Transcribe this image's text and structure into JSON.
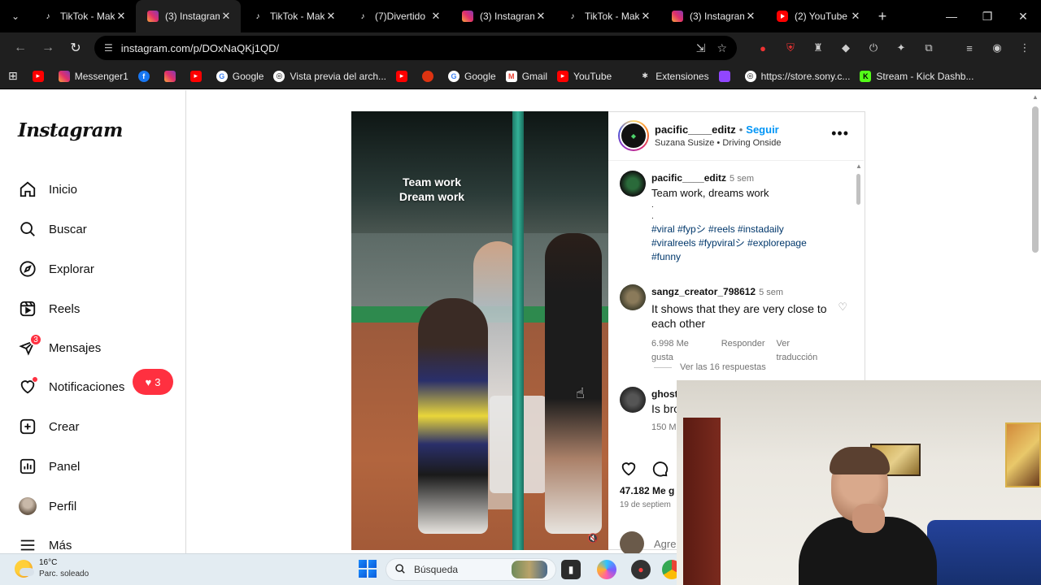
{
  "browser": {
    "tabs": [
      {
        "icon": "tiktok-icon",
        "title": "TikTok - Mak",
        "active": false
      },
      {
        "icon": "instagram-icon",
        "title": "(3) Instagram",
        "active": true
      },
      {
        "icon": "tiktok-icon",
        "title": "TikTok - Mak",
        "active": false
      },
      {
        "icon": "tiktok-icon",
        "title": "(7)Divertido",
        "active": false
      },
      {
        "icon": "instagram-icon",
        "title": "(3) Instagram",
        "active": false
      },
      {
        "icon": "tiktok-icon",
        "title": "TikTok - Mak",
        "active": false
      },
      {
        "icon": "instagram-icon",
        "title": "(3) Instagram",
        "active": false
      },
      {
        "icon": "youtube-icon",
        "title": "(2) YouTube",
        "active": false
      }
    ],
    "url": "instagram.com/p/DOxNaQKj1QD/",
    "bookmarks": [
      {
        "icon": "youtube-icon",
        "label": ""
      },
      {
        "icon": "instagram-icon",
        "label": "Messenger1"
      },
      {
        "icon": "facebook-icon",
        "label": ""
      },
      {
        "icon": "instagram-icon",
        "label": ""
      },
      {
        "icon": "youtube-icon",
        "label": ""
      },
      {
        "icon": "google-icon",
        "label": "Google"
      },
      {
        "icon": "web-icon",
        "label": "Vista previa del arch..."
      },
      {
        "icon": "youtube-icon",
        "label": ""
      },
      {
        "icon": "web-icon",
        "label": ""
      },
      {
        "icon": "google-icon",
        "label": "Google"
      },
      {
        "icon": "gmail-icon",
        "label": "Gmail"
      },
      {
        "icon": "youtube-icon",
        "label": "YouTube"
      },
      {
        "icon": "extensions-icon",
        "label": "Extensiones"
      },
      {
        "icon": "twitch-icon",
        "label": ""
      },
      {
        "icon": "web-icon",
        "label": "https://store.sony.c..."
      },
      {
        "icon": "kick-icon",
        "label": "Stream - Kick Dashb..."
      }
    ]
  },
  "instagram": {
    "logo": "Instagram",
    "nav": [
      {
        "label": "Inicio",
        "icon": "home-icon"
      },
      {
        "label": "Buscar",
        "icon": "search-icon"
      },
      {
        "label": "Explorar",
        "icon": "compass-icon"
      },
      {
        "label": "Reels",
        "icon": "reels-icon"
      },
      {
        "label": "Mensajes",
        "icon": "messenger-icon",
        "badge": "3"
      },
      {
        "label": "Notificaciones",
        "icon": "heart-icon"
      },
      {
        "label": "Crear",
        "icon": "plus-square-icon"
      },
      {
        "label": "Panel",
        "icon": "chart-icon"
      },
      {
        "label": "Perfil",
        "icon": "avatar-icon"
      },
      {
        "label": "Más",
        "icon": "menu-icon"
      }
    ],
    "notification_pill": "3",
    "post": {
      "overlay_text": "Team work\nDream work",
      "author": "pacific____editz",
      "follow": "Seguir",
      "music": "Suzana Susize • Driving Onside",
      "caption": {
        "user": "pacific____editz",
        "time": "5 sem",
        "text": "Team work, dreams work",
        "dots": ".",
        "dots2": ".",
        "hashtags_line1": "#viral #fypシ #reels #instadaily",
        "hashtags_line2": "#viralreels #fypviralシ #explorepage",
        "hashtags_line3": "#funny"
      },
      "comments": [
        {
          "user": "sangz_creator_798612",
          "time": "5 sem",
          "text": "It shows that they are very close to each other",
          "likes": "6.998 Me gusta",
          "reply": "Responder",
          "translate": "Ver traducción",
          "replies": "Ver las 16 respuestas"
        },
        {
          "user": "ghost",
          "text": "Is bro",
          "likes": "150 M"
        }
      ],
      "likes": "47.182 Me g",
      "date": "19 de septiem",
      "add_comment": "Agre"
    }
  },
  "taskbar": {
    "temp": "16°C",
    "weather": "Parc. soleado",
    "search_placeholder": "Búsqueda"
  }
}
